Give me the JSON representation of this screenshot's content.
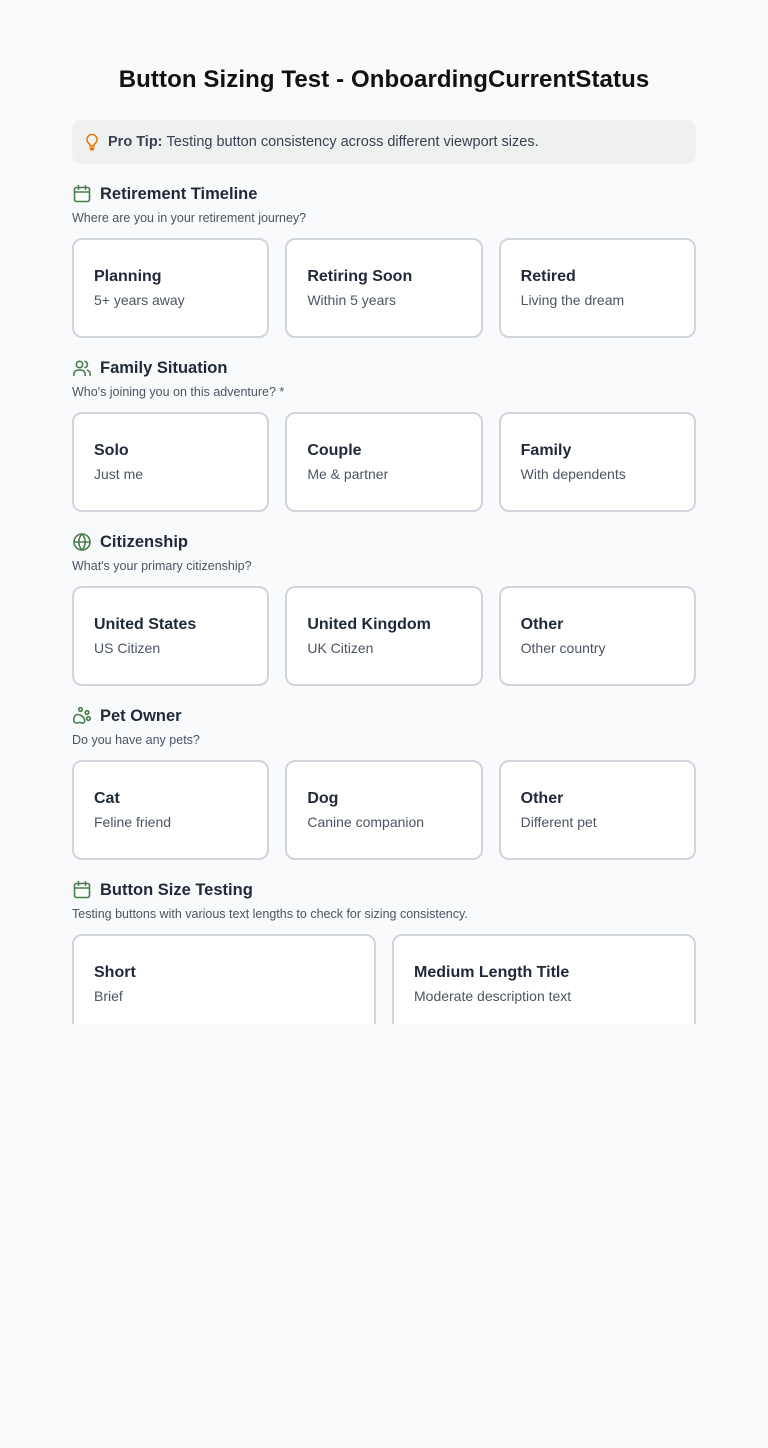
{
  "page_title": "Button Sizing Test - OnboardingCurrentStatus",
  "tip": {
    "label": "Pro Tip:",
    "text": "Testing button consistency across different viewport sizes."
  },
  "colors": {
    "accent": "#4a7c4e",
    "tip_icon": "#e8740c",
    "tip_bg": "#eef1ef",
    "card_border": "#d1d5db",
    "page_bg": "#f9fafb"
  },
  "sections": [
    {
      "icon": "calendar-icon",
      "title": "Retirement Timeline",
      "subtitle": "Where are you in your retirement journey?",
      "options": [
        {
          "title": "Planning",
          "desc": "5+ years away"
        },
        {
          "title": "Retiring Soon",
          "desc": "Within 5 years"
        },
        {
          "title": "Retired",
          "desc": "Living the dream"
        }
      ]
    },
    {
      "icon": "users-icon",
      "title": "Family Situation",
      "subtitle": "Who's joining you on this adventure? *",
      "options": [
        {
          "title": "Solo",
          "desc": "Just me"
        },
        {
          "title": "Couple",
          "desc": "Me & partner"
        },
        {
          "title": "Family",
          "desc": "With dependents"
        }
      ]
    },
    {
      "icon": "globe-icon",
      "title": "Citizenship",
      "subtitle": "What's your primary citizenship?",
      "options": [
        {
          "title": "United States",
          "desc": "US Citizen"
        },
        {
          "title": "United Kingdom",
          "desc": "UK Citizen"
        },
        {
          "title": "Other",
          "desc": "Other country"
        }
      ]
    },
    {
      "icon": "paw-icon",
      "title": "Pet Owner",
      "subtitle": "Do you have any pets?",
      "options": [
        {
          "title": "Cat",
          "desc": "Feline friend"
        },
        {
          "title": "Dog",
          "desc": "Canine companion"
        },
        {
          "title": "Other",
          "desc": "Different pet"
        }
      ]
    },
    {
      "icon": "calendar-icon",
      "title": "Button Size Testing",
      "subtitle": "Testing buttons with various text lengths to check for sizing consistency.",
      "options": [
        {
          "title": "Short",
          "desc": "Brief"
        },
        {
          "title": "Medium Length Title",
          "desc": "Moderate description text"
        }
      ]
    }
  ]
}
